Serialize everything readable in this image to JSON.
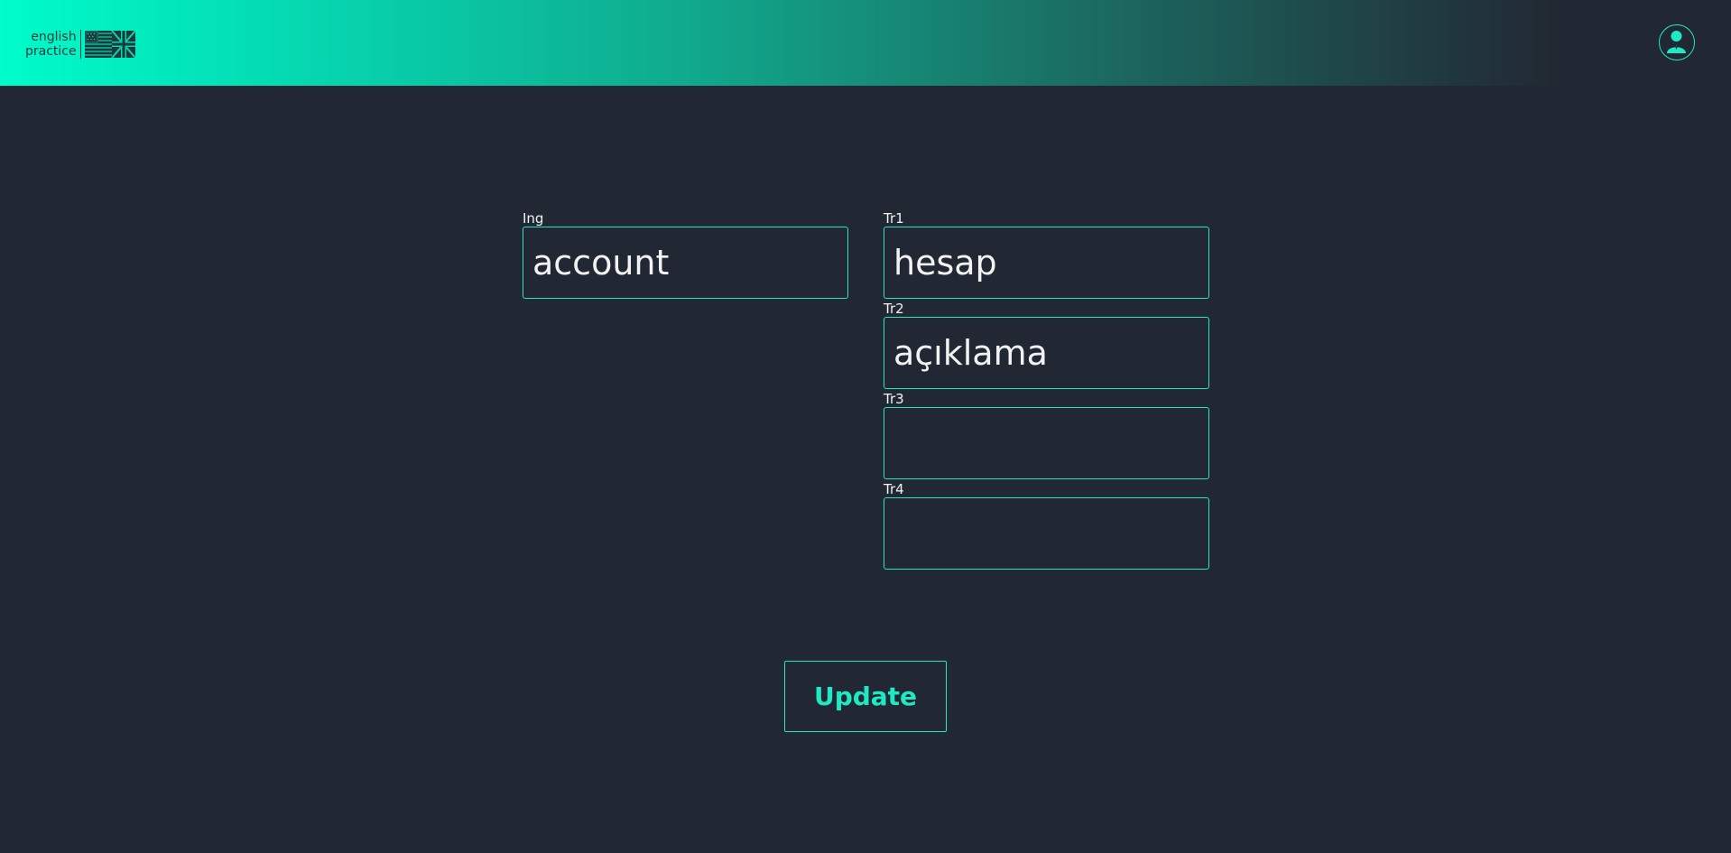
{
  "header": {
    "logo_line1": "english",
    "logo_line2": "practice",
    "profile_icon": "user-icon",
    "gradient_start": "#00fccb",
    "gradient_end": "#222833"
  },
  "form": {
    "ing": {
      "label": "Ing",
      "value": "account"
    },
    "tr1": {
      "label": "Tr1",
      "value": "hesap"
    },
    "tr2": {
      "label": "Tr2",
      "value": "açıklama"
    },
    "tr3": {
      "label": "Tr3",
      "value": ""
    },
    "tr4": {
      "label": "Tr4",
      "value": ""
    },
    "update_label": "Update"
  },
  "colors": {
    "background": "#222833",
    "accent": "#1ee9c3",
    "text": "#f2f2f2"
  }
}
